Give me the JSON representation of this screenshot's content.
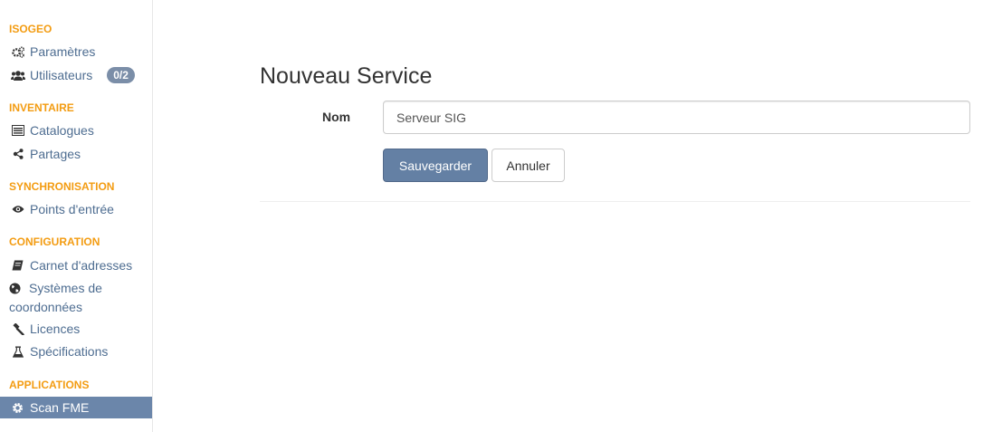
{
  "sidebar": {
    "sections": [
      {
        "title": "ISOGEO"
      },
      {
        "title": "INVENTAIRE"
      },
      {
        "title": "SYNCHRONISATION"
      },
      {
        "title": "CONFIGURATION"
      },
      {
        "title": "APPLICATIONS"
      }
    ],
    "items": {
      "parametres": {
        "label": "Paramètres",
        "icon": "cogs-icon"
      },
      "utilisateurs": {
        "label": "Utilisateurs",
        "icon": "users-icon",
        "badge": "0/2"
      },
      "catalogues": {
        "label": "Catalogues",
        "icon": "list-icon"
      },
      "partages": {
        "label": "Partages",
        "icon": "share-icon"
      },
      "points_entree": {
        "label": "Points d'entrée",
        "icon": "eye-icon"
      },
      "carnet": {
        "label": "Carnet d'adresses",
        "icon": "book-icon"
      },
      "systemes_line1": "Systèmes de",
      "systemes_line2": "coordonnées",
      "licences": {
        "label": "Licences",
        "icon": "gavel-icon"
      },
      "specifications": {
        "label": "Spécifications",
        "icon": "flask-icon"
      },
      "scan_fme": {
        "label": "Scan FME",
        "icon": "cog-icon",
        "active": true
      }
    }
  },
  "main": {
    "title": "Nouveau Service",
    "form": {
      "nom_label": "Nom",
      "nom_value": "Serveur SIG",
      "save_label": "Sauvegarder",
      "cancel_label": "Annuler"
    }
  },
  "colors": {
    "accent": "#f39c12",
    "link": "#4e6d91",
    "primary": "#6480a4",
    "active_bg": "#6b86aa"
  }
}
